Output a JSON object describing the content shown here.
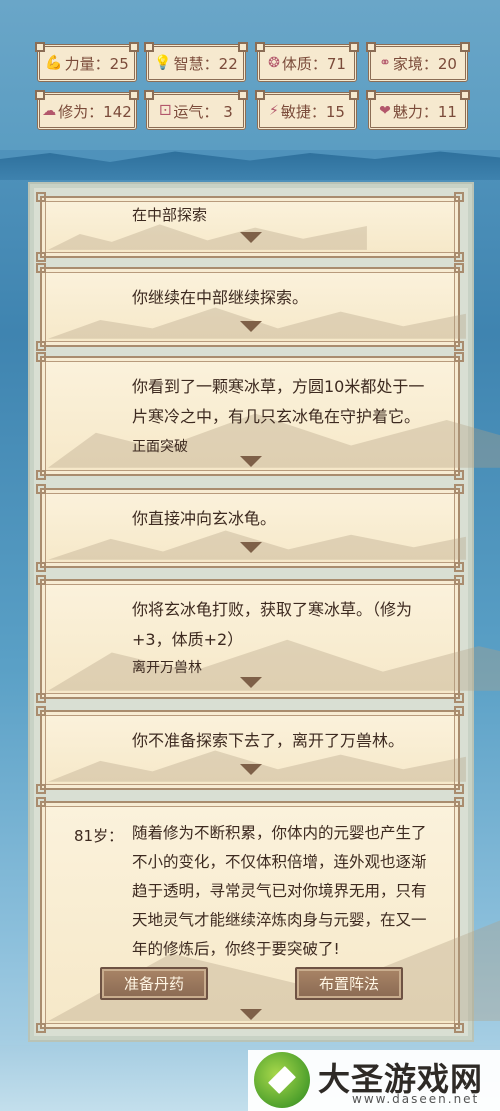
{
  "stats": [
    {
      "icon": "muscle-icon",
      "glyph": "💪",
      "label": "力量：25"
    },
    {
      "icon": "lightbulb-icon",
      "glyph": "💡",
      "label": "智慧：22"
    },
    {
      "icon": "heart-ring-icon",
      "glyph": "❂",
      "label": "体质：71"
    },
    {
      "icon": "family-icon",
      "glyph": "⚭",
      "label": "家境：20"
    },
    {
      "icon": "cloud-icon",
      "glyph": "☁",
      "label": "修为：142"
    },
    {
      "icon": "dice-icon",
      "glyph": "⚀",
      "label": "运气： 3"
    },
    {
      "icon": "lightning-icon",
      "glyph": "⚡",
      "label": "敏捷：15"
    },
    {
      "icon": "charm-heart-icon",
      "glyph": "❤",
      "label": "魅力：11"
    }
  ],
  "events": [
    {
      "text": "在中部探索",
      "choice": ""
    },
    {
      "text": "你继续在中部继续探索。",
      "choice": ""
    },
    {
      "text": "你看到了一颗寒冰草，方圆10米都处于一片寒冷之中，有几只玄冰龟在守护着它。",
      "choice": "正面突破"
    },
    {
      "text": "你直接冲向玄冰龟。",
      "choice": ""
    },
    {
      "text": "你将玄冰龟打败，获取了寒冰草。（修为+3，体质+2）",
      "choice": "离开万兽林"
    },
    {
      "text": "你不准备探索下去了，离开了万兽林。",
      "choice": ""
    }
  ],
  "current": {
    "age": "81岁：",
    "text": "随着修为不断积累，你体内的元婴也产生了不小的变化，不仅体积倍增，连外观也逐渐趋于透明，寻常灵气已对你境界无用，只有天地灵气才能继续淬炼肉身与元婴，在又一年的修炼后，你终于要突破了!",
    "options": [
      "准备丹药",
      "布置阵法"
    ]
  },
  "watermark": {
    "title": "大圣游戏网",
    "url": "www.daseen.net"
  }
}
